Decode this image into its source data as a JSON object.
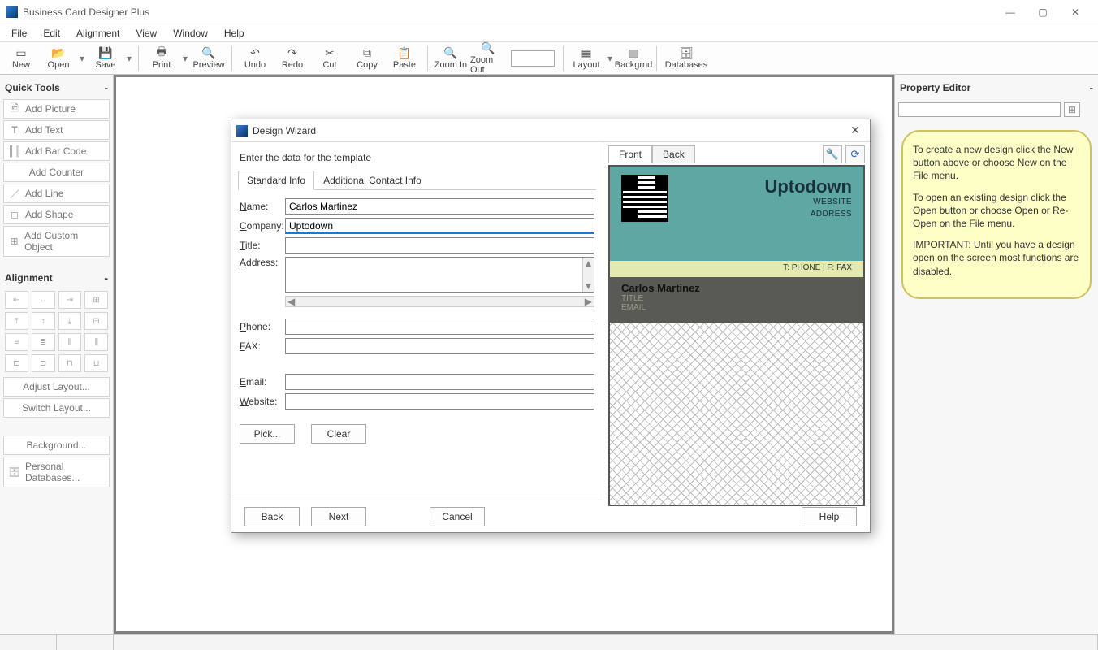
{
  "app": {
    "title": "Business Card Designer Plus"
  },
  "menu": {
    "items": [
      "File",
      "Edit",
      "Alignment",
      "View",
      "Window",
      "Help"
    ]
  },
  "toolbar": {
    "new": "New",
    "open": "Open",
    "save": "Save",
    "print": "Print",
    "preview": "Preview",
    "undo": "Undo",
    "redo": "Redo",
    "cut": "Cut",
    "copy": "Copy",
    "paste": "Paste",
    "zoomin": "Zoom In",
    "zoomout": "Zoom Out",
    "layout": "Layout",
    "backgrnd": "Backgrnd",
    "databases": "Databases"
  },
  "quicktools": {
    "title": "Quick Tools",
    "items": [
      "Add Picture",
      "Add Text",
      "Add Bar Code",
      "Add Counter",
      "Add Line",
      "Add Shape",
      "Add Custom Object"
    ],
    "alignment": "Alignment",
    "adjust": "Adjust Layout...",
    "switch": "Switch Layout...",
    "background": "Background...",
    "personaldb": "Personal Databases..."
  },
  "property": {
    "title": "Property Editor",
    "hint1": "To create a new design click the New button above or choose New on the File menu.",
    "hint2": "To open an existing design click the Open button or choose Open or Re-Open on the File menu.",
    "hint3": "IMPORTANT: Until you have a design open on the screen most functions are disabled."
  },
  "dialog": {
    "title": "Design Wizard",
    "subtitle": "Enter the data for the template",
    "tabs": {
      "standard": "Standard Info",
      "additional": "Additional Contact Info"
    },
    "labels": {
      "name": "Name:",
      "company": "Company:",
      "title": "Title:",
      "address": "Address:",
      "phone": "Phone:",
      "fax": "FAX:",
      "email": "Email:",
      "website": "Website:"
    },
    "values": {
      "name": "Carlos Martinez",
      "company": "Uptodown",
      "title": "",
      "address": "",
      "phone": "",
      "fax": "",
      "email": "",
      "website": ""
    },
    "pick": "Pick...",
    "clear": "Clear",
    "sidetabs": {
      "front": "Front",
      "back": "Back"
    },
    "buttons": {
      "back": "Back",
      "next": "Next",
      "cancel": "Cancel",
      "help": "Help"
    }
  },
  "preview": {
    "company": "Uptodown",
    "website": "WEBSITE",
    "address": "ADDRESS",
    "phonefax": "T: PHONE  |  F: FAX",
    "name": "Carlos Martinez",
    "title": "TITLE",
    "email": "EMAIL"
  }
}
